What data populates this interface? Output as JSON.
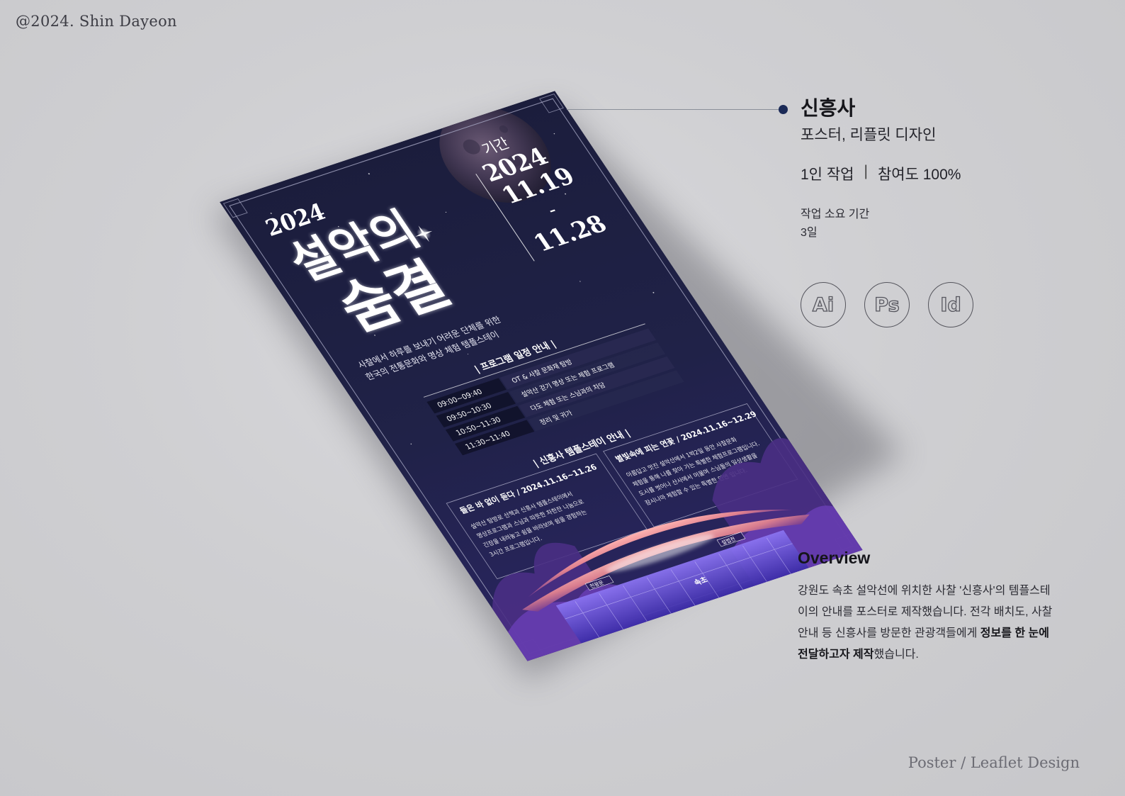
{
  "copyright": "@2024. Shin Dayeon",
  "footer_tag": "Poster / Leaflet Design",
  "project": {
    "client": "신흥사",
    "subtitle": "포스터, 리플릿 디자인",
    "team": "1인 작업",
    "participation": "참여도 100%",
    "duration_label": "작업 소요 기간",
    "duration_value": "3일"
  },
  "tools": [
    {
      "label": "Ai",
      "icon": "illustrator-icon"
    },
    {
      "label": "Ps",
      "icon": "photoshop-icon"
    },
    {
      "label": "Id",
      "icon": "indesign-icon"
    }
  ],
  "overview": {
    "heading": "Overview",
    "body_before": "강원도 속초 설악선에 위치한 사찰 '신흥사'의 템플스테이의 안내를 포스터로 제작했습니다. 전각 배치도, 사찰안내 등 신흥사를 방문한 관광객들에게 ",
    "body_bold": "정보를 한 눈에 전달하고자 제작",
    "body_after": "했습니다."
  },
  "poster": {
    "year": "2024",
    "title_line1": "설악의",
    "title_line2": "숨결",
    "period_label": "기간",
    "period_year": "2024",
    "period_start": "11.19",
    "period_dash": "-",
    "period_end": "11.28",
    "tagline_1": "사찰에서 하루를 보내기 어려운 단체를 위한",
    "tagline_2": "한국의 전통문화와 명상 체험 템플스테이",
    "schedule_heading": "| 프로그램 일정 안내 |",
    "schedule": [
      {
        "time": "09:00~09:40",
        "program": "OT & 사찰 문화재 탐방"
      },
      {
        "time": "09:50~10:30",
        "program": "설악산 걷기 명상 또는 체험 프로그램"
      },
      {
        "time": "10:50~11:30",
        "program": "다도 체험 또는 스님과의 차담"
      },
      {
        "time": "11:30~11:40",
        "program": "정리 및 귀가"
      }
    ],
    "templestay_heading": "| 신흥사 템플스테이 안내 |",
    "program_a": {
      "title": "별빛속에 피는 연꽃 / 2024.11.16~12.29",
      "lines": [
        "아름답고 멋진 설악산에서 1박2일 동안 사찰문화",
        "체험을 통해 나를 찾아 가는 특별한 체험프로그램입니다.",
        "도시를 벗어나 산사에서 머물며 스님들의 일상생활을",
        "잠시나마 체험할 수 있는 특별한 인연 입니다."
      ]
    },
    "program_b": {
      "title": "들은 바 없이 듣다 / 2024.11.16~11.26",
      "lines": [
        "설악산 탐방로 산책과 신흥사 템플스테이에서",
        "명상프로그램과 스님과 따뜻한 차한잔 나눔으로",
        "긴장을 내려놓고 쉼을 바라보며 쉼을 경험하는",
        "3시간 프로그램입니다."
      ]
    },
    "gate_left": "천왕문",
    "gate_right": "설법전",
    "hall_label": "속초"
  }
}
